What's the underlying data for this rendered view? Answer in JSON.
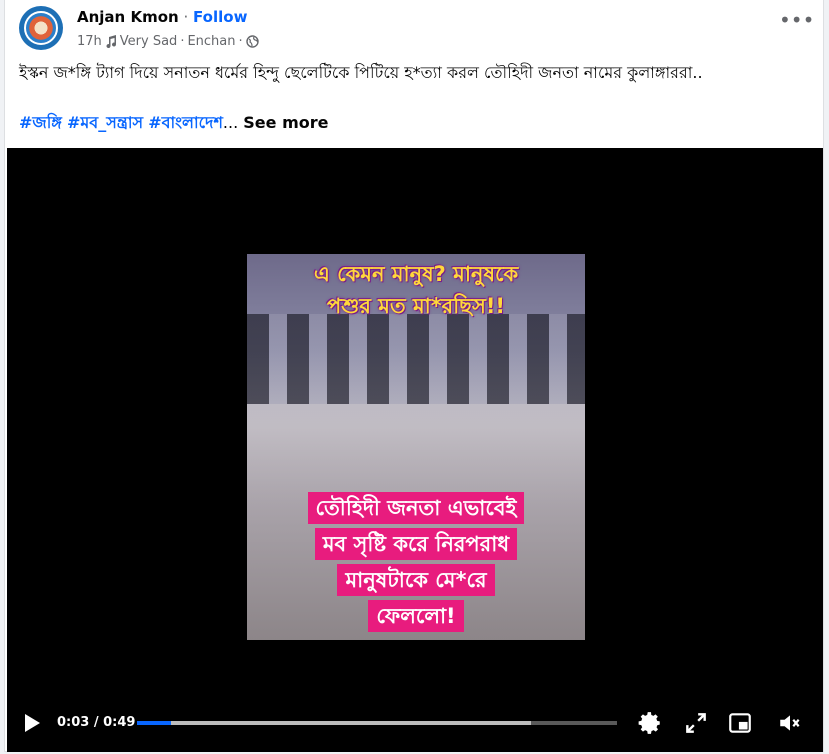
{
  "post": {
    "author": "Anjan Kmon",
    "separator": "·",
    "follow_label": "Follow",
    "time": "17h",
    "audio_track": "Very Sad",
    "audio_artist": "Enchan",
    "privacy_icon": "globe-icon",
    "more_label": "•••",
    "text": "ইস্কন জ*ঙ্গি ট্যাগ দিয়ে সনাতন ধর্মের হিন্দু ছেলেটিকে পিটিয়ে হ*ত্যা করল তৌহিদী জনতা নামের কুলাঙ্গাররা..",
    "hashtags": [
      "#জঙ্গি",
      "#মব_সন্ত্রাস",
      "#বাংলাদেশ"
    ],
    "ellipsis": "...",
    "see_more": "See more"
  },
  "video": {
    "caption_top": [
      "এ কেমন মানুষ? মানুষকে",
      "পশুর মত মা*রছিস!!"
    ],
    "caption_bottom": [
      "তৌহিদী জনতা এভাবেই",
      "মব সৃষ্টি করে নিরপরাধ",
      "মানুষটাকে মে*রে",
      "ফেললো!"
    ],
    "current_time": "0:03",
    "duration": "0:49",
    "time_display": "0:03 / 0:49",
    "progress_fraction": 0.07,
    "buffered_fraction": 0.82,
    "controls": [
      "play-icon",
      "settings-icon",
      "fullscreen-icon",
      "picture-in-picture-icon",
      "mute-icon"
    ]
  },
  "colors": {
    "accent": "#0866ff",
    "caption_yellow": "#ffd83b",
    "caption_pink": "#e81c7e"
  }
}
